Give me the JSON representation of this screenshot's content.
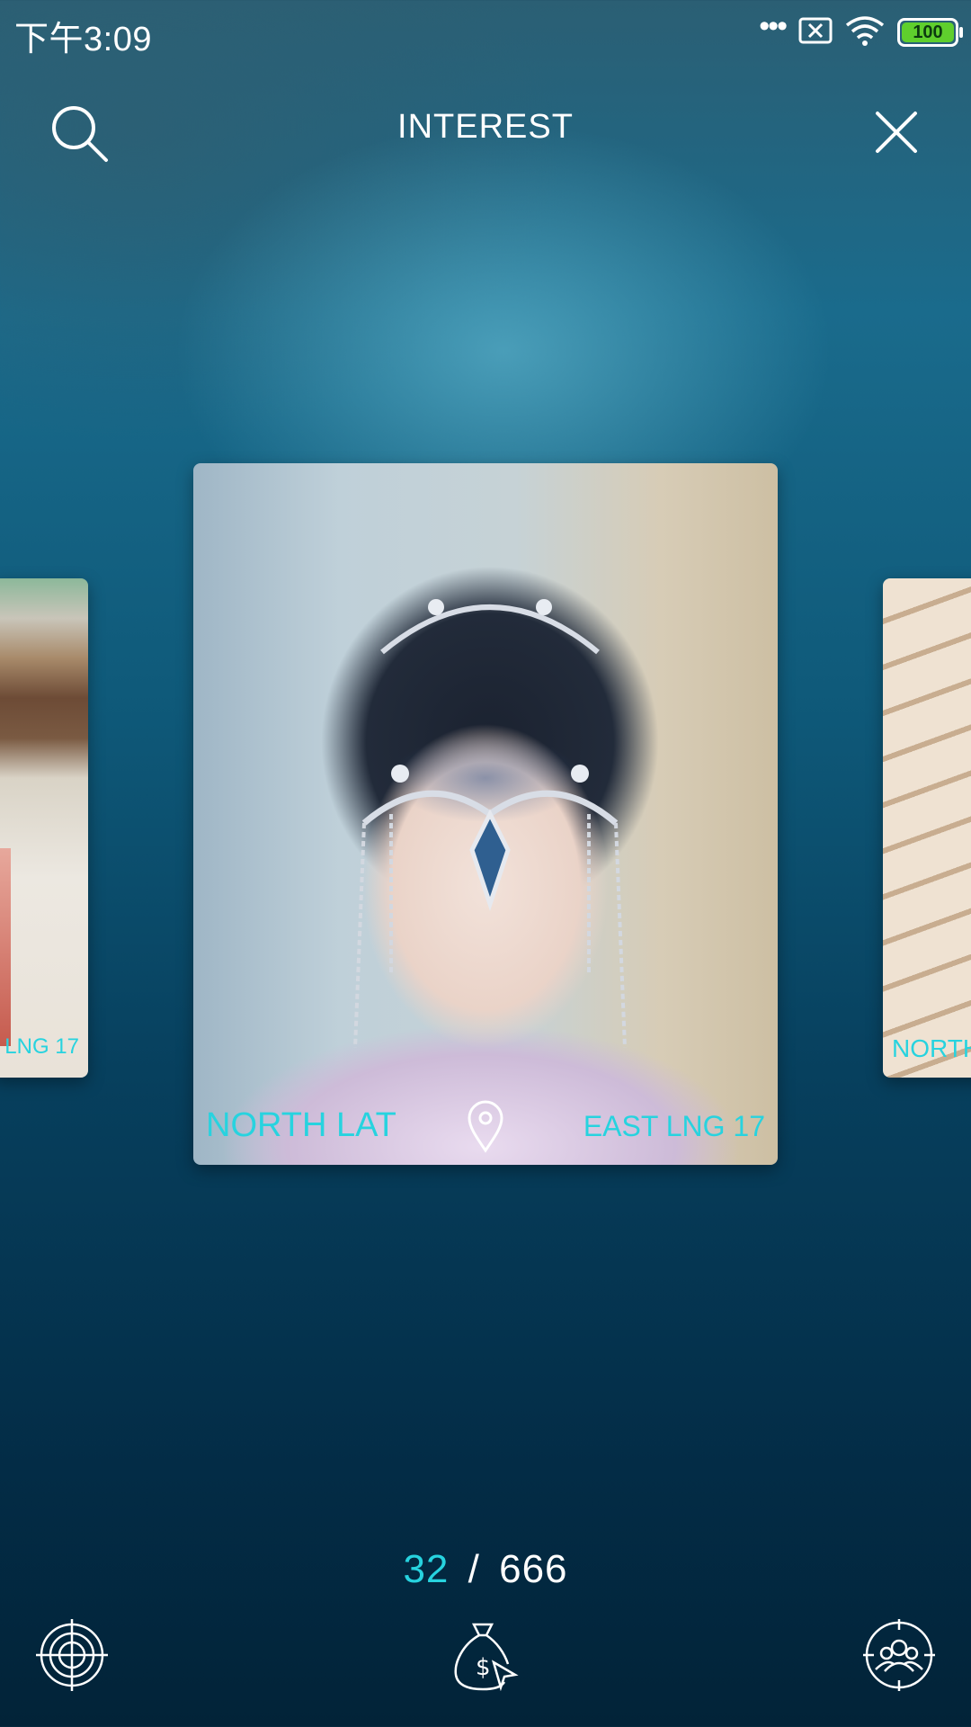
{
  "status_bar": {
    "time": "下午3:09",
    "battery": "100",
    "icons": [
      "more-dots-icon",
      "sim-x-icon",
      "wifi-icon",
      "battery-icon"
    ]
  },
  "header": {
    "title": "INTEREST",
    "icons": [
      "search-icon",
      "close-icon"
    ]
  },
  "cards": {
    "left": {
      "label": "LNG 17"
    },
    "center": {
      "lat_label": "NORTH LAT",
      "lng_label": "EAST LNG 17",
      "icon": "location-pin-icon"
    },
    "right": {
      "label": "NORTH"
    }
  },
  "pager": {
    "current": "32",
    "separator": "/",
    "total": "666"
  },
  "bottom_nav": {
    "icons": [
      "crosshair-icon",
      "money-bag-icon",
      "group-target-icon"
    ]
  },
  "colors": {
    "accent": "#27d3df",
    "battery": "#5fcf2d"
  }
}
